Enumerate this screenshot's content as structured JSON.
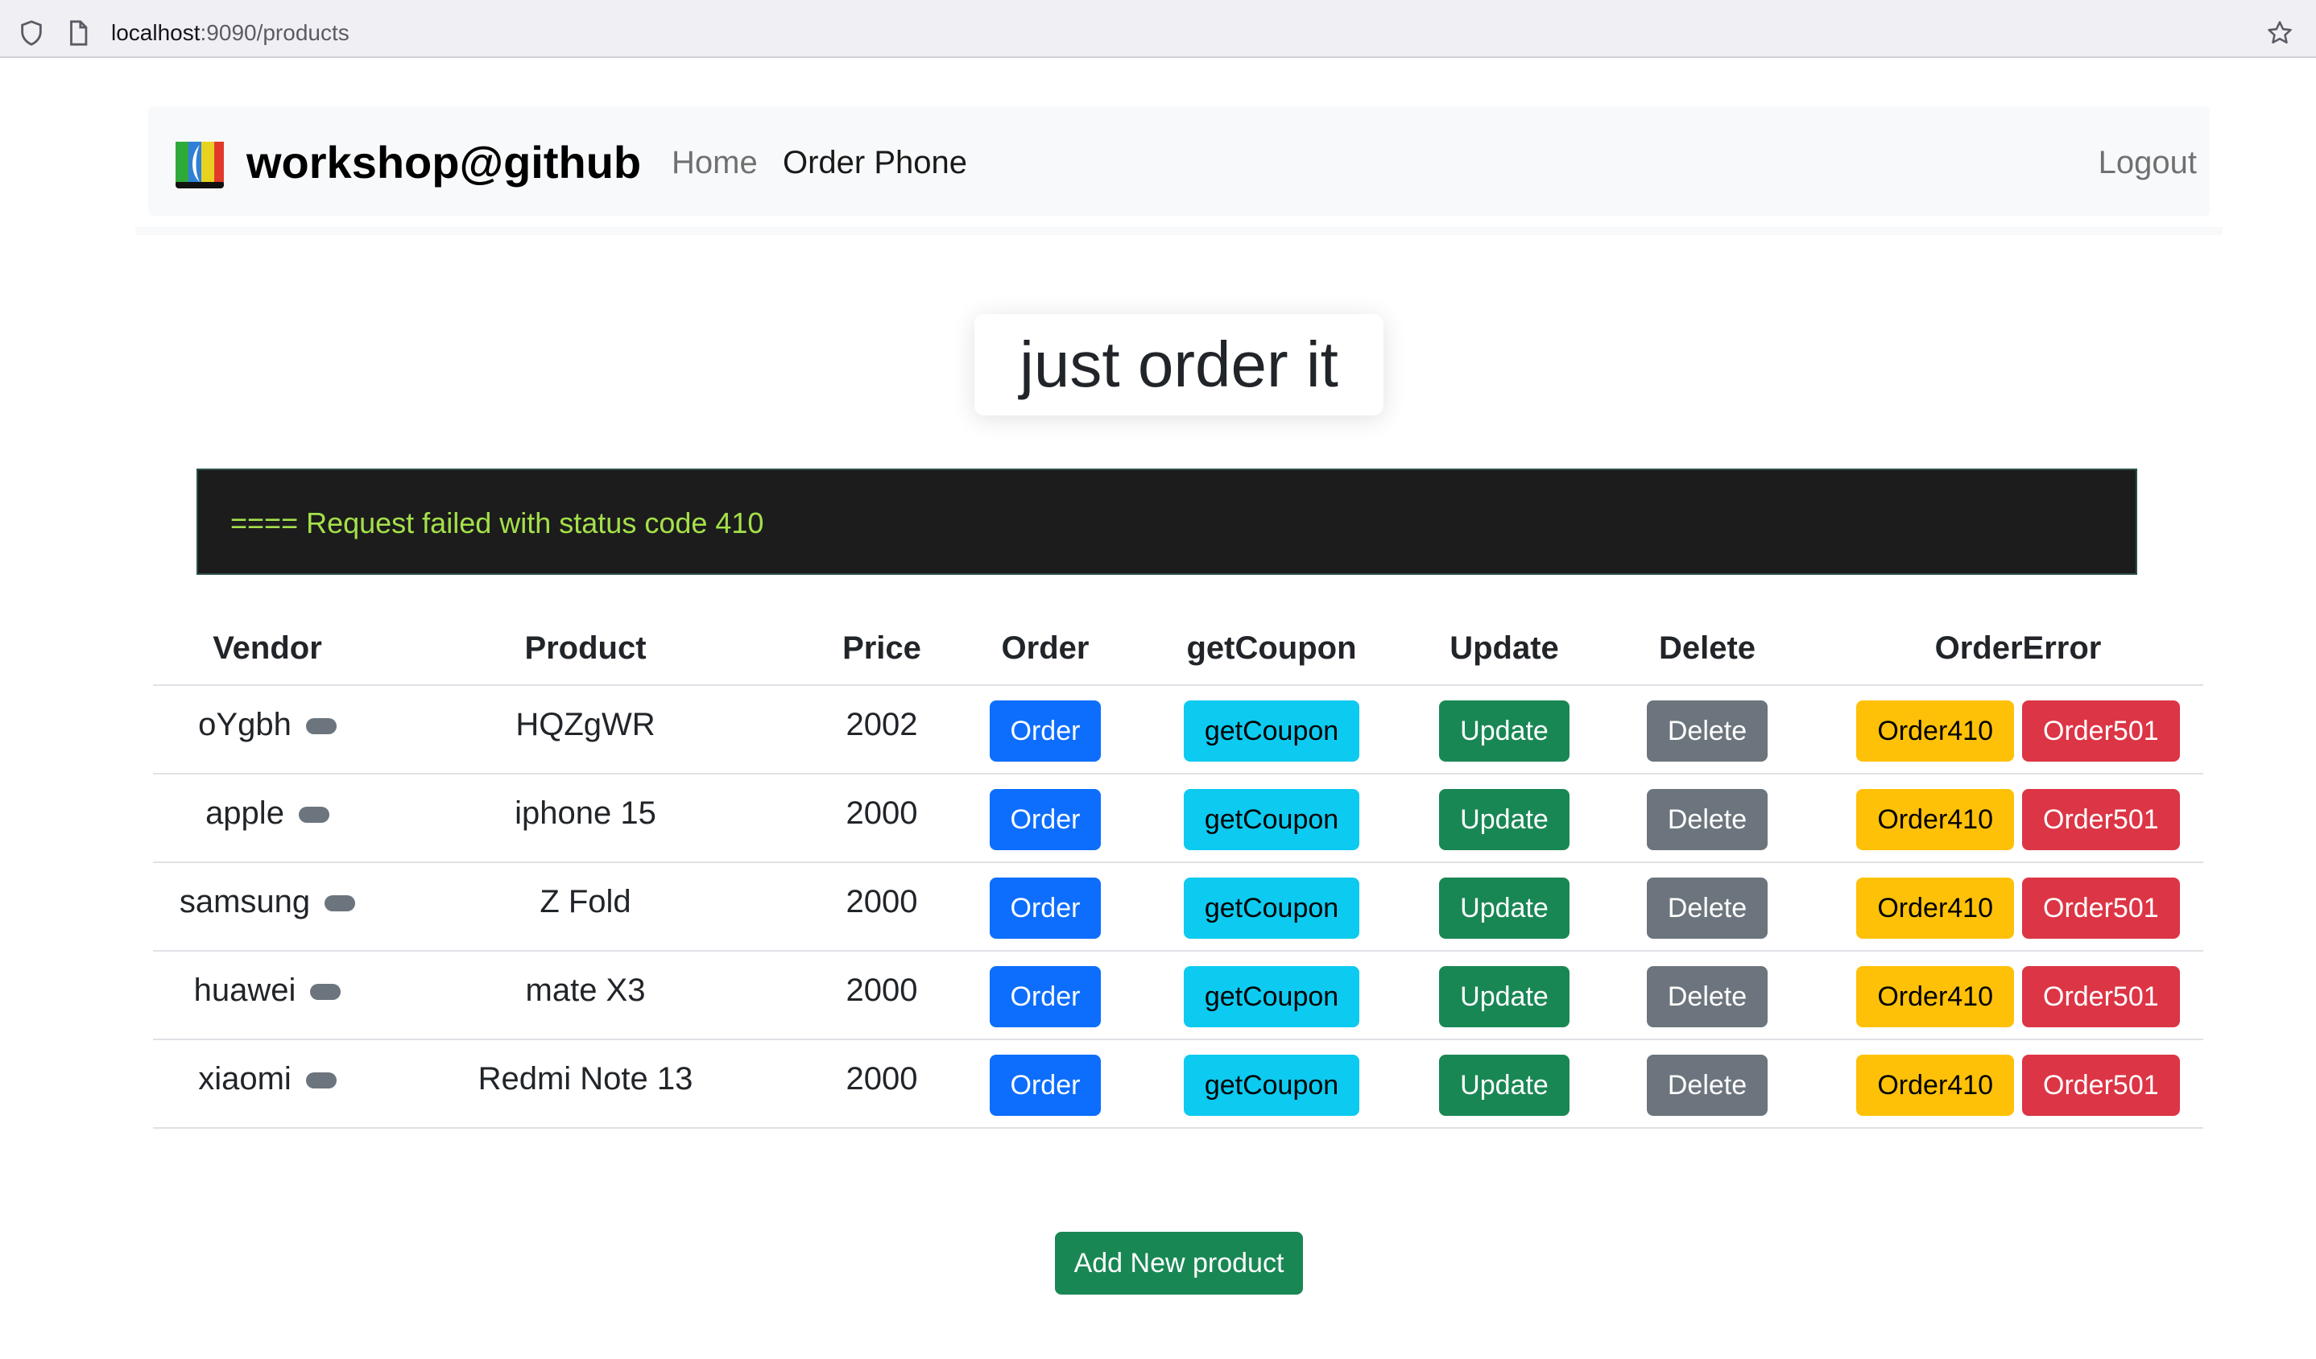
{
  "browser": {
    "url_host": "localhost",
    "url_rest": ":9090/products"
  },
  "navbar": {
    "brand": "workshop@github",
    "links": [
      "Home",
      "Order Phone"
    ],
    "logout": "Logout"
  },
  "page_title": "just order it",
  "console_message": "==== Request failed with status code 410",
  "table": {
    "headers": [
      "Vendor",
      "Product",
      "Price",
      "Order",
      "getCoupon",
      "Update",
      "Delete",
      "OrderError"
    ],
    "rows": [
      {
        "vendor": "oYgbh",
        "product": "HQZgWR",
        "price": "2002"
      },
      {
        "vendor": "apple",
        "product": "iphone 15",
        "price": "2000"
      },
      {
        "vendor": "samsung",
        "product": "Z Fold",
        "price": "2000"
      },
      {
        "vendor": "huawei",
        "product": "mate X3",
        "price": "2000"
      },
      {
        "vendor": "xiaomi",
        "product": "Redmi Note 13",
        "price": "2000"
      }
    ],
    "buttons": {
      "order": "Order",
      "coupon": "getCoupon",
      "update": "Update",
      "delete": "Delete",
      "order410": "Order410",
      "order501": "Order501"
    }
  },
  "add_button": "Add New product",
  "colors": {
    "primary": "#0d6efd",
    "info": "#0dcaf0",
    "success": "#198754",
    "secondary": "#6c757d",
    "warning": "#ffc107",
    "danger": "#dc3545",
    "console_bg": "#1c1c1c",
    "console_text": "#a4e04a"
  },
  "icons": {
    "shield": "shield-icon",
    "page": "page-icon",
    "star": "bookmark-star-icon",
    "logo": "brand-logo-icon"
  }
}
